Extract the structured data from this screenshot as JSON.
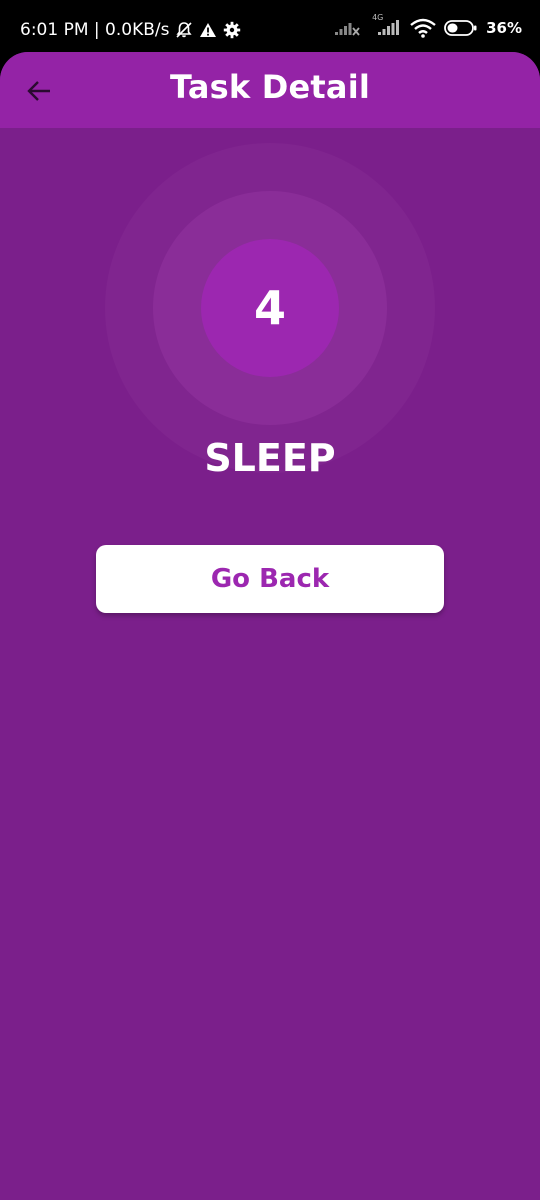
{
  "status_bar": {
    "time_speed": "6:01 PM | 0.0KB/s",
    "network_label": "4G",
    "battery_percent": "36%",
    "icons": [
      "bell-off-icon",
      "warning-icon",
      "gear-icon",
      "signal-icon",
      "signal-4g-icon",
      "wifi-icon",
      "battery-icon"
    ]
  },
  "app_bar": {
    "title": "Task Detail",
    "back_icon": "arrow-left-icon"
  },
  "task": {
    "number": "4",
    "name": "SLEEP"
  },
  "actions": {
    "go_back_label": "Go Back"
  },
  "colors": {
    "background": "#7b1f8b",
    "app_bar": "#9423a6",
    "accent": "#9c27b0",
    "button_bg": "#ffffff"
  }
}
